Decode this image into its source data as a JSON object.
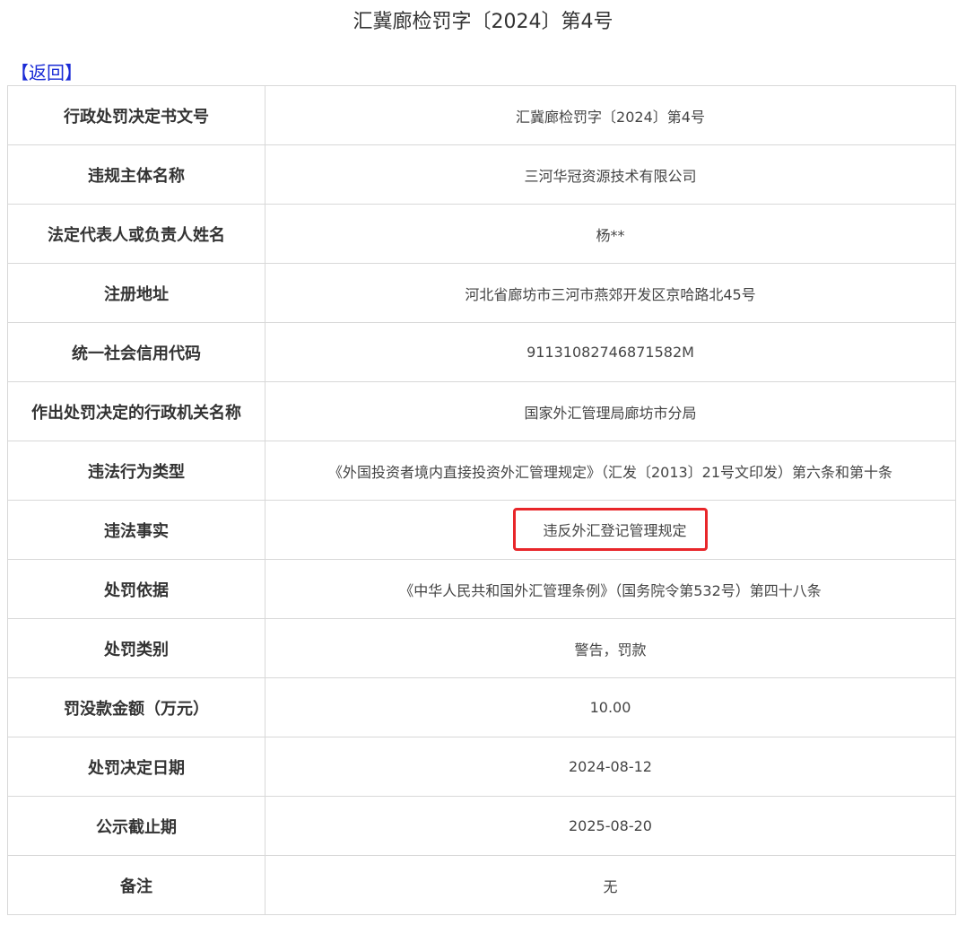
{
  "page": {
    "title": "汇冀廊检罚字〔2024〕第4号"
  },
  "nav": {
    "back_open": "【",
    "back_label": "返回",
    "back_close": "】"
  },
  "rows": [
    {
      "label": "行政处罚决定书文号",
      "value": "汇冀廊检罚字〔2024〕第4号"
    },
    {
      "label": "违规主体名称",
      "value": "三河华冠资源技术有限公司"
    },
    {
      "label": "法定代表人或负责人姓名",
      "value": "杨**"
    },
    {
      "label": "注册地址",
      "value": "河北省廊坊市三河市燕郊开发区京哈路北45号"
    },
    {
      "label": "统一社会信用代码",
      "value": "91131082746871582M"
    },
    {
      "label": "作出处罚决定的行政机关名称",
      "value": "国家外汇管理局廊坊市分局"
    },
    {
      "label": "违法行为类型",
      "value": "《外国投资者境内直接投资外汇管理规定》（汇发〔2013〕21号文印发）第六条和第十条"
    },
    {
      "label": "违法事实",
      "value": "违反外汇登记管理规定"
    },
    {
      "label": "处罚依据",
      "value": "《中华人民共和国外汇管理条例》（国务院令第532号）第四十八条"
    },
    {
      "label": "处罚类别",
      "value": "警告，罚款"
    },
    {
      "label": "罚没款金额（万元）",
      "value": "10.00"
    },
    {
      "label": "处罚决定日期",
      "value": "2024-08-12"
    },
    {
      "label": "公示截止期",
      "value": "2025-08-20"
    },
    {
      "label": "备注",
      "value": "无"
    }
  ],
  "colors": {
    "link": "#1a2bd6",
    "highlight_border": "#e8262a",
    "table_border": "#d8d8d8"
  }
}
